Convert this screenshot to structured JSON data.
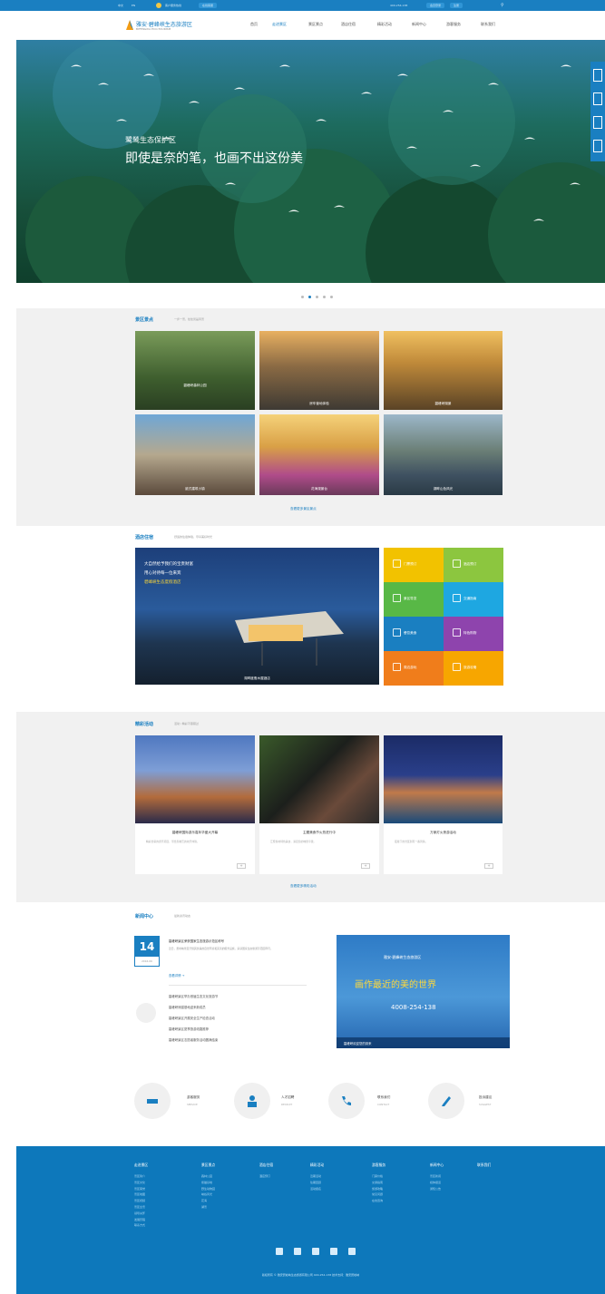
{
  "topbar": {
    "items": [
      "中文",
      "EN",
      "客户服务热线",
      "在线客服"
    ],
    "hotline": "400-254-138",
    "login": "会员登录",
    "register": "注册"
  },
  "header": {
    "logo_name": "雅安·碧峰峡生态旅游区",
    "logo_sub": "BIFENGXIA ECO-TOURISM",
    "nav": [
      "首页",
      "走进景区",
      "景区景点",
      "酒店住宿",
      "精彩活动",
      "新闻中心",
      "游客服务",
      "联系我们"
    ]
  },
  "hero": {
    "kicker": "鹭鸶生态保护区",
    "headline": "即使是奈的笔，也画不出这份美"
  },
  "section_scenic": {
    "title": "景区景点",
    "subtitle": "一步一景，处处皆是风景",
    "tiles": [
      "碧峰峡森林公园",
      "房车营地体验",
      "碧峰峡湖景",
      "欧式建筑小镇",
      "花海观景台",
      "湖畔山色风光"
    ],
    "more": "查看更多景区景点"
  },
  "section_hotel": {
    "title": "酒店住宿",
    "subtitle": "舒适的住宿体验，尽享美好时光",
    "main_caption": "湖畔度假木屋酒店",
    "promo_line1": "大自然给予我们的宝贵财富",
    "promo_line2": "用心对待每一位来宾",
    "promo_line3": "碧峰峡生态度假酒店",
    "grid": [
      {
        "label": "门票预订",
        "color": "#f2c200"
      },
      {
        "label": "酒店预订",
        "color": "#8cc63f"
      },
      {
        "label": "景区导览",
        "color": "#58b846"
      },
      {
        "label": "交通指南",
        "color": "#1ea7e1"
      },
      {
        "label": "餐饮美食",
        "color": "#1a7fc1"
      },
      {
        "label": "特色购物",
        "color": "#8e44ad"
      },
      {
        "label": "周边游玩",
        "color": "#f07d1b"
      },
      {
        "label": "旅游攻略",
        "color": "#f7a600"
      }
    ]
  },
  "section_events": {
    "title": "精彩活动",
    "subtitle": "活动 / 精彩不容错过",
    "cards": [
      {
        "title": "碧峰峡国际游乐嘉年华盛大开幕",
        "desc": "精彩纷呈的游乐项目，带给您难忘的欢乐体验。"
      },
      {
        "title": "主题美食节火热进行中",
        "desc": "汇聚各地特色美食，满足您的味蕾享受。"
      },
      {
        "title": "万家灯火夜游活动",
        "desc": "夜幕下的景区别有一番风情。"
      }
    ],
    "more": "查看更多精彩活动"
  },
  "section_news": {
    "title": "新闻中心",
    "subtitle": "最新资讯动态",
    "date_day": "14",
    "date_month": "2016-06",
    "lead_title": "碧峰峡景区荣获国家生态旅游示范区称号",
    "lead_desc": "近日，碧峰峡景区凭借其优美的自然环境和完善的服务设施，荣获国家生态旅游示范区称号。",
    "lead_more": "查看详情 →",
    "list": [
      "碧峰峡景区举办首届生态文化旅游节",
      "碧峰峡熊猫基地迎来新成员",
      "碧峰峡景区开展安全生产检查活动",
      "碧峰峡景区夏季旅游线路推荐",
      "碧峰峡景区志愿者服务活动圆满结束"
    ],
    "ad_brand": "雅安·碧峰峡生态旅游区",
    "ad_headline": "画作最近的美的世界",
    "ad_phone": "4008-254-138",
    "ad_caption": "碧峰峡欢迎您的到来"
  },
  "services": [
    {
      "title": "游客服务",
      "sub": "SERVICE",
      "icon": "hand-icon"
    },
    {
      "title": "人才招聘",
      "sub": "RECRUIT",
      "icon": "person-icon"
    },
    {
      "title": "联系我们",
      "sub": "CONTACT",
      "icon": "phone-icon"
    },
    {
      "title": "投诉建议",
      "sub": "SUGGEST",
      "icon": "pen-icon"
    }
  ],
  "footer": {
    "columns": [
      {
        "head": "走进景区",
        "items": [
          "景区简介",
          "景区文化",
          "景区荣誉",
          "景区地图",
          "景区视频",
          "景区全景",
          "领导关怀",
          "发展历程",
          "联系方式"
        ]
      },
      {
        "head": "景区景点",
        "items": [
          "森林公园",
          "熊猫基地",
          "野生动物园",
          "峡谷风光",
          "花海",
          "湖景"
        ]
      },
      {
        "head": "酒店住宿",
        "items": [
          "酒店预订"
        ]
      },
      {
        "head": "精彩活动",
        "items": [
          "近期活动",
          "往期回顾",
          "活动报名"
        ]
      },
      {
        "head": "游客服务",
        "items": [
          "门票价格",
          "交通指南",
          "旅游攻略",
          "常见问题",
          "在线咨询"
        ]
      },
      {
        "head": "新闻中心",
        "items": [
          "景区新闻",
          "媒体报道",
          "通知公告"
        ]
      },
      {
        "head": "联系我们",
        "items": []
      }
    ],
    "copyright": "版权所有 © 雅安碧峰峡生态旅游有限公司 400-254-138 技术支持：雅安碧峰峡"
  },
  "colors": {
    "brand": "#1a7fc1",
    "footer": "#0d78bb",
    "section_gray": "#f1f1f1"
  }
}
